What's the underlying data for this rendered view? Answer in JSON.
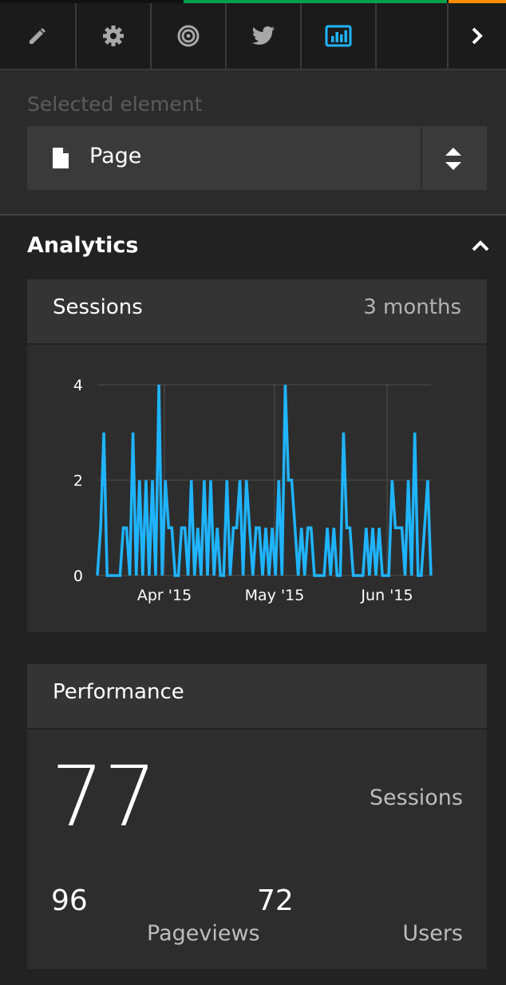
{
  "tabs": [
    {
      "name": "pencil-icon",
      "active": false
    },
    {
      "name": "gear-icon",
      "active": false
    },
    {
      "name": "target-icon",
      "active": false
    },
    {
      "name": "twitter-icon",
      "active": false
    },
    {
      "name": "bar-chart-icon",
      "active": true
    },
    {
      "name": "blank-tab",
      "active": false
    },
    {
      "name": "chevron-right-icon",
      "active": false
    }
  ],
  "colors": {
    "accent": "#1fb4ff",
    "background": "#222222",
    "panel": "#2d2d2d",
    "header": "#343434"
  },
  "selected": {
    "label": "Selected element",
    "value": "Page"
  },
  "analytics": {
    "title": "Analytics"
  },
  "sessions_card": {
    "title": "Sessions",
    "range": "3 months"
  },
  "chart_data": {
    "type": "line",
    "y_ticks": [
      "0",
      "2",
      "4"
    ],
    "x_ticks": [
      "Apr '15",
      "May '15",
      "Jun '15"
    ],
    "ylim": [
      0,
      4
    ],
    "grid": true,
    "series": [
      {
        "values": [
          0,
          1,
          3,
          0,
          0,
          0,
          0,
          0,
          1,
          1,
          0,
          3,
          0,
          2,
          0,
          2,
          0,
          2,
          0,
          4,
          0,
          2,
          1,
          1,
          0,
          0,
          1,
          1,
          0,
          2,
          0,
          1,
          0,
          2,
          0,
          2,
          0,
          1,
          0,
          0,
          2,
          0,
          1,
          1,
          2,
          0,
          2,
          1,
          0,
          1,
          1,
          0,
          1,
          0,
          1,
          0,
          2,
          0,
          4,
          2,
          2,
          1,
          0,
          1,
          0,
          1,
          1,
          0,
          0,
          0,
          0,
          1,
          0,
          1,
          0,
          0,
          3,
          1,
          1,
          0,
          0,
          0,
          0,
          1,
          0,
          1,
          0,
          1,
          0,
          0,
          0,
          2,
          1,
          1,
          1,
          0,
          2,
          0,
          3,
          0,
          0,
          1,
          2,
          0
        ]
      }
    ]
  },
  "performance_card": {
    "title": "Performance",
    "sessions_value": "77",
    "sessions_label": "Sessions",
    "pageviews_value": "96",
    "pageviews_label": "Pageviews",
    "users_value": "72",
    "users_label": "Users"
  }
}
